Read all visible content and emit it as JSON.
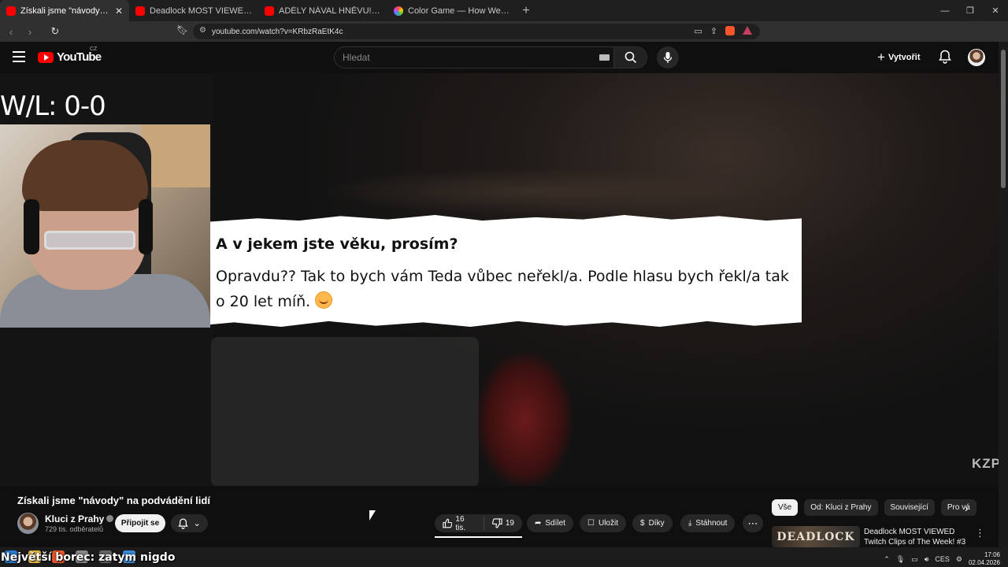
{
  "browser": {
    "tabs": [
      {
        "title": "Získali jsme \"návody\" na podv",
        "active": true,
        "favicon": "youtube"
      },
      {
        "title": "Deadlock MOST VIEWED Twitch Clip",
        "active": false,
        "favicon": "youtube"
      },
      {
        "title": "ADÉLY NÁVAL HNĚVU! - YouTube",
        "active": false,
        "favicon": "youtube"
      },
      {
        "title": "Color Game — How Well Can You Re",
        "active": false,
        "favicon": "color-wheel"
      }
    ],
    "url": "youtube.com/watch?v=KRbzRaEtK4c"
  },
  "youtube": {
    "country_code": "CZ",
    "logo_text": "YouTube",
    "search_placeholder": "Hledat",
    "create_label": "Vytvořit"
  },
  "player": {
    "overlay_wl": "W/L: 0-0",
    "note_question": "A v jekem jste věku, prosím?",
    "note_answer": "Opravdu?? Tak to bych vám Teda vůbec neřekl/a. Podle hlasu bych řekl/a tak o 20 let míň.",
    "watermark": "KZP"
  },
  "video": {
    "title": "Získali jsme \"návody\" na podvádění lidí",
    "channel_name": "Kluci z Prahy",
    "subscribers": "729 tis. odběratelů",
    "join_label": "Připojit se",
    "likes": "16 tis.",
    "dislikes": "19",
    "share_label": "Sdílet",
    "save_label": "Uložit",
    "thanks_label": "Díky",
    "download_label": "Stáhnout"
  },
  "chips": [
    "Vše",
    "Od: Kluci z Prahy",
    "Související",
    "Pro vá"
  ],
  "recommendation": {
    "thumb_text": "DEADLOCK",
    "title": "Deadlock MOST VIEWED Twitch Clips of The Week! #3"
  },
  "stream_overlay": "Největší borec: zatym nigdo",
  "taskbar": {
    "lang": "CES",
    "time": "17:06",
    "date": "02.04.2026"
  }
}
